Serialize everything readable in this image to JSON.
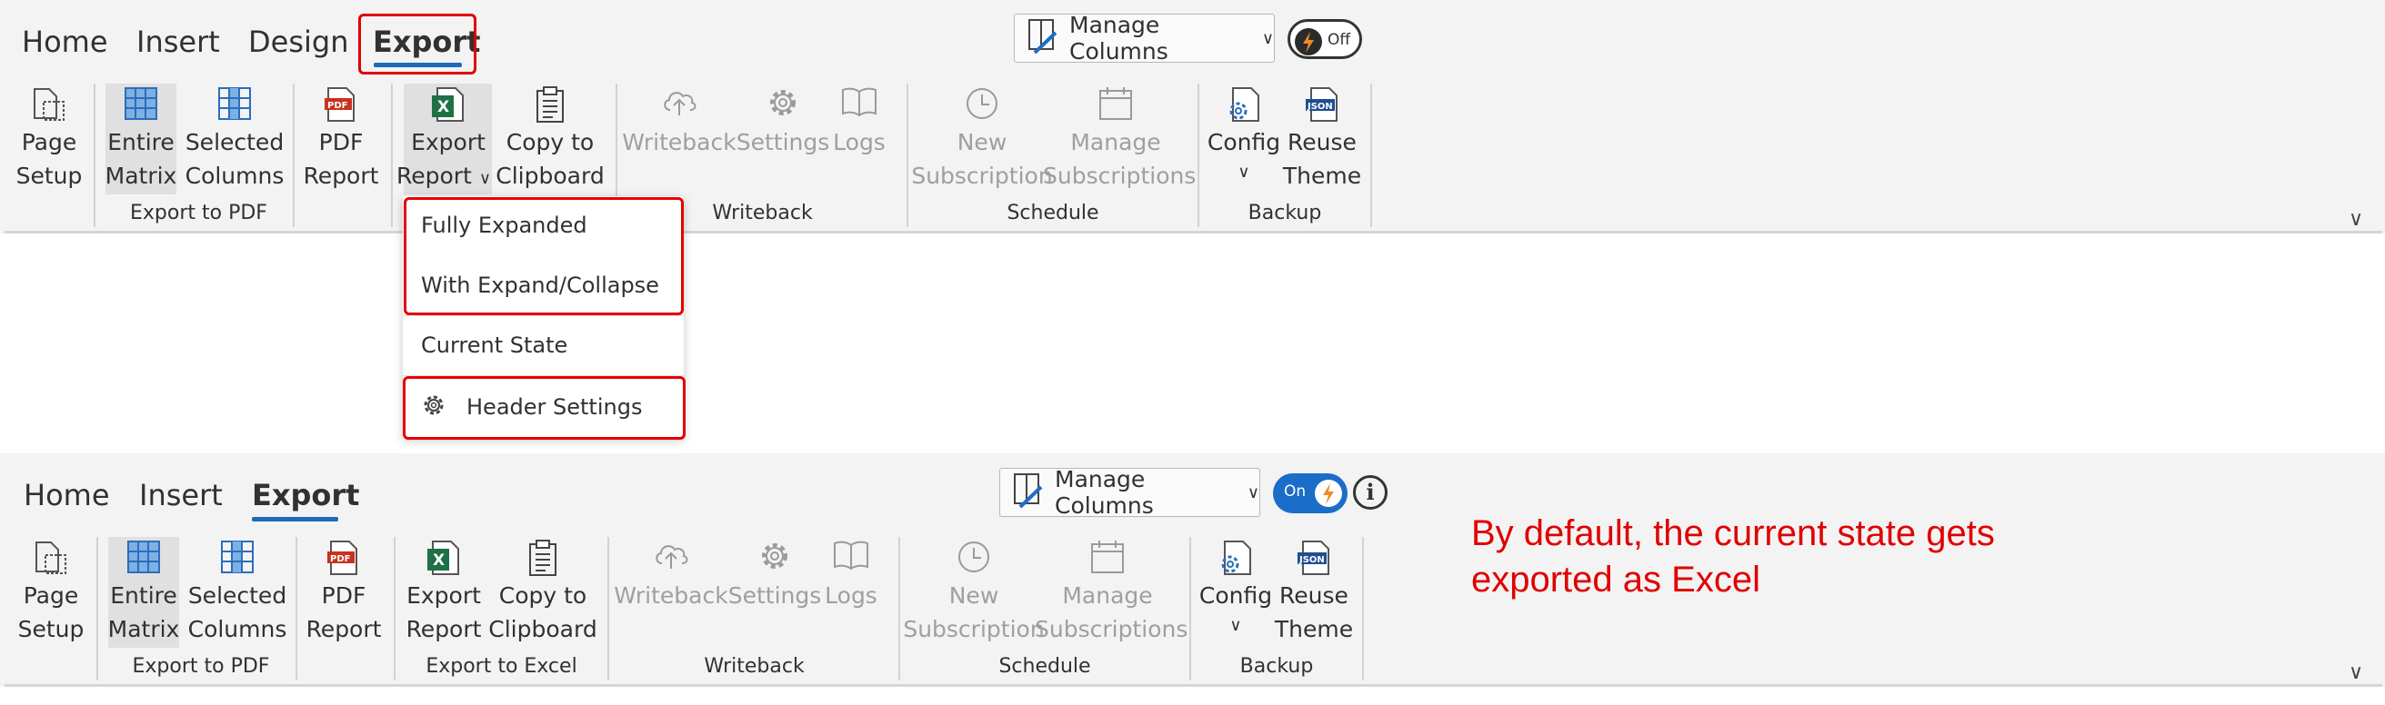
{
  "ribbon_top": {
    "tabs": [
      "Home",
      "Insert",
      "Design",
      "Export"
    ],
    "manage_columns": "Manage Columns",
    "toggle": "Off",
    "groups": {
      "export_pdf": {
        "label": "Export to PDF",
        "page_setup": [
          "Page",
          "Setup"
        ],
        "entire_matrix": [
          "Entire",
          "Matrix"
        ],
        "selected_columns": [
          "Selected",
          "Columns"
        ],
        "pdf_report": [
          "PDF",
          "Report"
        ]
      },
      "export_excel": {
        "export_report": [
          "Export",
          "Report"
        ],
        "copy_clipboard": [
          "Copy to",
          "Clipboard"
        ]
      },
      "writeback": {
        "label": "Writeback",
        "writeback": "Writeback",
        "settings": "Settings",
        "logs": "Logs"
      },
      "schedule": {
        "label": "Schedule",
        "new_subscription": [
          "New",
          "Subscription"
        ],
        "manage_subscriptions": [
          "Manage",
          "Subscriptions"
        ]
      },
      "backup": {
        "label": "Backup",
        "config": "Config",
        "reuse_theme": [
          "Reuse",
          "Theme"
        ]
      }
    }
  },
  "dropdown": {
    "items": [
      "Fully Expanded",
      "With Expand/Collapse",
      "Current State",
      "Header Settings"
    ]
  },
  "ribbon_bottom": {
    "tabs": [
      "Home",
      "Insert",
      "Export"
    ],
    "manage_columns": "Manage Columns",
    "toggle": "On",
    "info": "i",
    "groups": {
      "export_pdf": {
        "label": "Export to PDF",
        "page_setup": [
          "Page",
          "Setup"
        ],
        "entire_matrix": [
          "Entire",
          "Matrix"
        ],
        "selected_columns": [
          "Selected",
          "Columns"
        ],
        "pdf_report": [
          "PDF",
          "Report"
        ]
      },
      "export_excel": {
        "label": "Export to Excel",
        "export_report": [
          "Export",
          "Report"
        ],
        "copy_clipboard": [
          "Copy to",
          "Clipboard"
        ]
      },
      "writeback": {
        "label": "Writeback",
        "writeback": "Writeback",
        "settings": "Settings",
        "logs": "Logs"
      },
      "schedule": {
        "label": "Schedule",
        "new_subscription": [
          "New",
          "Subscription"
        ],
        "manage_subscriptions": [
          "Manage",
          "Subscriptions"
        ]
      },
      "backup": {
        "label": "Backup",
        "config": "Config",
        "reuse_theme": [
          "Reuse",
          "Theme"
        ]
      }
    }
  },
  "annotation": "By default, the current state gets exported as Excel",
  "colors": {
    "accent": "#1d6ab9",
    "highlight_box": "#e60000",
    "annotation": "#e00000",
    "toggle_on": "#1c6dc9",
    "excel_green": "#1e7145",
    "pdf_red": "#c8321e"
  },
  "icons": [
    "page-setup-icon",
    "matrix-grid-icon",
    "columns-grid-icon",
    "pdf-file-icon",
    "excel-file-icon",
    "clipboard-icon",
    "cloud-upload-icon",
    "gear-icon",
    "book-icon",
    "clock-icon",
    "calendar-icon",
    "config-file-icon",
    "json-file-icon",
    "lightning-icon",
    "info-icon",
    "chevron-down-icon"
  ]
}
